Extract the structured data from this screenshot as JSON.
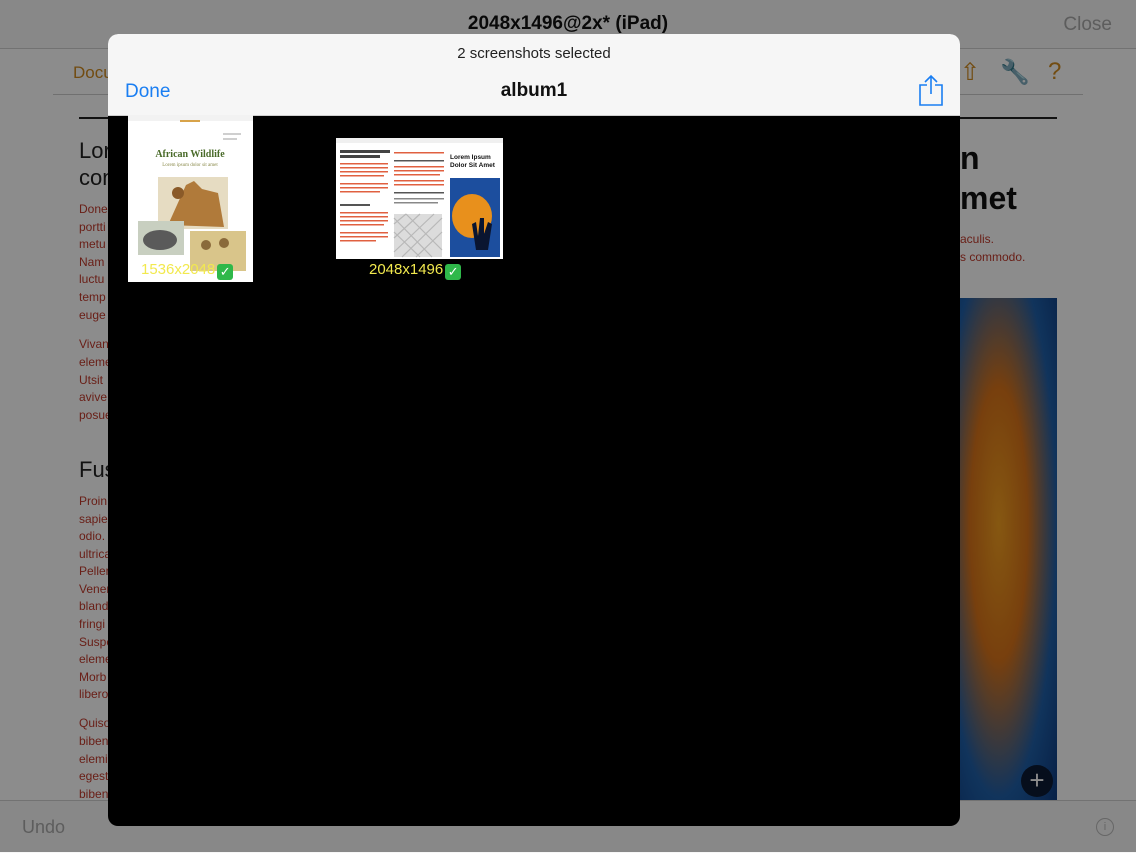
{
  "background": {
    "window_title": "2048x1496@2x* (iPad)",
    "close_label": "Close",
    "doc_tab_label": "Docu",
    "undo_label": "Undo",
    "heading_1": "Lor",
    "heading_1b": "con",
    "heading_2": "Fus",
    "big_heading_1": "n",
    "big_heading_2": "met",
    "red_right_1": "aculis.",
    "red_right_2": "s commodo.",
    "text_fragments": [
      "Done",
      "portti",
      "metu",
      "Nam",
      "luctu",
      "temp",
      "euge",
      "Vivan",
      "eleme",
      "Utsit",
      "avive",
      "posue",
      "Proin",
      "sapie",
      "odio.",
      "ultrica",
      "Peller",
      "Vener",
      "bland",
      "fringi",
      "Suspe",
      "eleme",
      "Morb",
      "libero",
      "Quiso",
      "biben",
      "elemi",
      "egest",
      "biben"
    ]
  },
  "modal": {
    "selection_status": "2 screenshots selected",
    "done_label": "Done",
    "album_title": "album1",
    "screenshots": [
      {
        "label": "1536x2048",
        "checked": true,
        "doc_title": "African Wildlife",
        "doc_subtitle": "Lorem ipsum dolor sit amet"
      },
      {
        "label": "2048x1496",
        "checked": true,
        "doc_title": "Lorem Ipsum Dolor Sit Amet"
      }
    ]
  },
  "colors": {
    "accent": "#1a7ef2",
    "label_yellow": "#f2e94e",
    "check_green": "#2fb84a",
    "doc_orange": "#d08a20",
    "doc_red": "#c0392b"
  }
}
